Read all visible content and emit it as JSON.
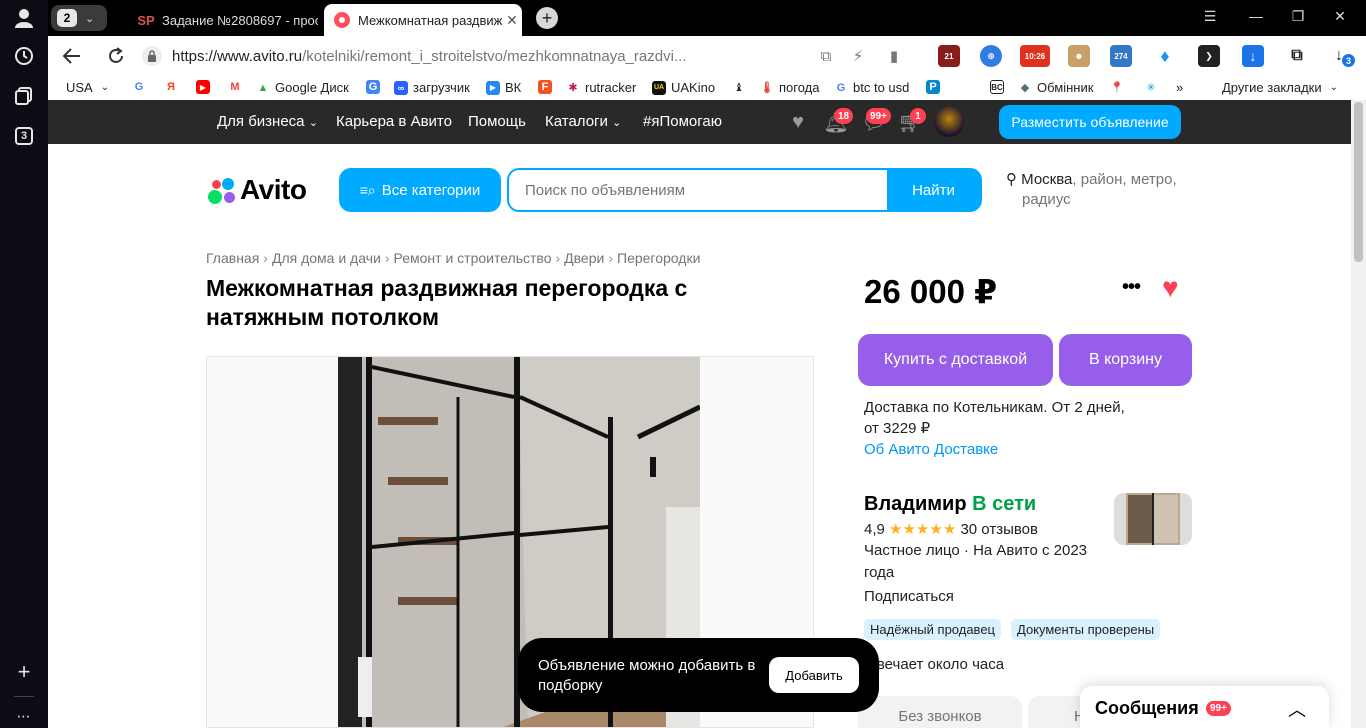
{
  "browser": {
    "tab_group_count": "2",
    "tabs": [
      {
        "label": "Задание №2808697 - прос",
        "favicon": "SP"
      },
      {
        "label": "Межкомнатная раздвиж"
      }
    ],
    "url_host": "https://www.avito.ru",
    "url_path": "/kotelniki/remont_i_stroitelstvo/mezhkomnatnaya_razdvi...",
    "side_panel_count": "3",
    "download_badge": "3",
    "extensions": [
      "21",
      "10:26",
      "274"
    ],
    "bookmarks": [
      {
        "label": "USA",
        "icon": "chevron-down"
      },
      {
        "label": "",
        "icon": "G"
      },
      {
        "label": "",
        "icon": "Я"
      },
      {
        "label": "",
        "icon": "youtube"
      },
      {
        "label": "",
        "icon": "gmail"
      },
      {
        "label": "Google Диск",
        "icon": "drive"
      },
      {
        "label": "",
        "icon": "translate"
      },
      {
        "label": "загрузчик",
        "icon": "loader"
      },
      {
        "label": "ВК",
        "icon": "vk"
      },
      {
        "label": "",
        "icon": "F"
      },
      {
        "label": "rutracker",
        "icon": "rutracker"
      },
      {
        "label": "UAKino",
        "icon": "uakino"
      },
      {
        "label": "",
        "icon": "chess"
      },
      {
        "label": "погода",
        "icon": "thermometer"
      },
      {
        "label": "btc to usd",
        "icon": "G"
      },
      {
        "label": "",
        "icon": "P"
      },
      {
        "label": "",
        "icon": "BC"
      },
      {
        "label": "Обмінник",
        "icon": "exchange"
      },
      {
        "label": "",
        "icon": "maps"
      },
      {
        "label": "",
        "icon": "asterisk"
      },
      {
        "label": "»",
        "icon": ""
      },
      {
        "label": "Другие закладки",
        "icon": "chevron-down"
      }
    ]
  },
  "avito_header": {
    "nav": [
      "Для бизнеса",
      "Карьера в Авито",
      "Помощь",
      "Каталоги",
      "#яПомогаю"
    ],
    "notifications_badge": "18",
    "messages_badge": "99+",
    "cart_badge": "1",
    "post_ad_label": "Разместить объявление"
  },
  "search": {
    "logo_text": "Avito",
    "categories_label": "Все категории",
    "placeholder": "Поиск по объявлениям",
    "find_label": "Найти",
    "location_city": "Москва",
    "location_hint": ", район, метро,",
    "location_hint2": "радиус"
  },
  "breadcrumbs": [
    "Главная",
    "Для дома и дачи",
    "Ремонт и строительство",
    "Двери",
    "Перегородки"
  ],
  "listing": {
    "title": "Межкомнатная раздвижная перегородка с натяжным потолком",
    "price": "26 000 ₽",
    "buy_label": "Купить с доставкой",
    "cart_label": "В корзину",
    "delivery_line1": "Доставка по Котельникам. От 2 дней,",
    "delivery_line2": "от 3229 ₽",
    "delivery_link": "Об Авито Доставке"
  },
  "seller": {
    "name": "Владимир",
    "status": "В сети",
    "rating": "4,9",
    "stars": "★★★★★",
    "reviews": "30 отзывов",
    "info": "Частное лицо · На Авито с 2023 года",
    "subscribe": "Подписаться",
    "tags": [
      "Надёжный продавец",
      "Документы проверены"
    ],
    "reply_time": "твечает около часа",
    "contact_left": "Без звонков",
    "contact_right": "Н"
  },
  "toast": {
    "text": "Объявление можно добавить в подборку",
    "button": "Добавить"
  },
  "messenger": {
    "label": "Сообщения",
    "badge": "99+"
  },
  "colors": {
    "accent_blue": "#00aaff",
    "buy_purple": "#965eeb",
    "badge_red": "#ff4053",
    "online_green": "#00a046",
    "link_blue": "#0099f7"
  }
}
